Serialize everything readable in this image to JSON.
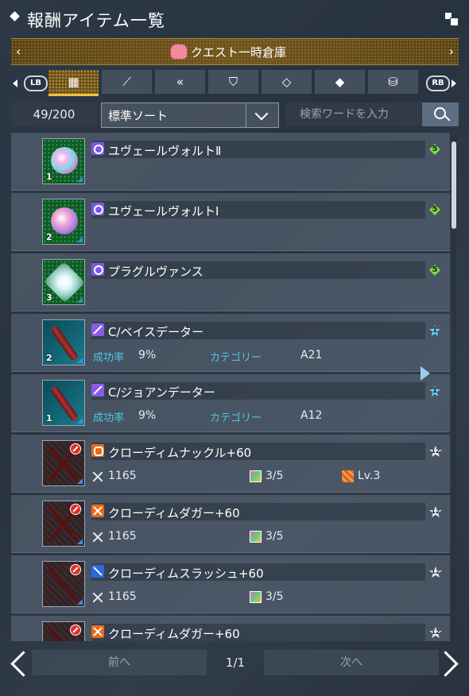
{
  "title": "報酬アイテム一覧",
  "category_banner": {
    "label": "クエスト一時倉庫"
  },
  "tabs": {
    "lb_label": "LB",
    "rb_label": "RB",
    "items": [
      {
        "name": "all-items",
        "icon": "grid-icon"
      },
      {
        "name": "weapons",
        "icon": "sword-icon"
      },
      {
        "name": "units",
        "icon": "double-chevron-icon"
      },
      {
        "name": "costumes",
        "icon": "shirt-icon"
      },
      {
        "name": "consumables",
        "icon": "tag-icon"
      },
      {
        "name": "materials",
        "icon": "diamond-arrow-icon"
      },
      {
        "name": "other",
        "icon": "bag-icon"
      }
    ]
  },
  "filters": {
    "count": "49/200",
    "sort_value": "標準ソート",
    "search_placeholder": "検索ワードを入力"
  },
  "items": [
    {
      "name": "ユヴェールヴォルトⅡ",
      "qty": "1",
      "type_icon": "violet",
      "rarity": "5"
    },
    {
      "name": "ユヴェールヴォルトⅠ",
      "qty": "2",
      "type_icon": "violet",
      "rarity": "5"
    },
    {
      "name": "プラグルヴァンス",
      "qty": "3",
      "type_icon": "violet",
      "rarity": "5"
    },
    {
      "name": "C/ベイスデーター",
      "qty": "2",
      "type_icon": "purple",
      "rarity": "1",
      "success_label": "成功率",
      "success_value": "9%",
      "category_label": "カテゴリー",
      "category_value": "A21"
    },
    {
      "name": "C/ジョアンデーター",
      "qty": "1",
      "type_icon": "purple",
      "rarity": "1",
      "success_label": "成功率",
      "success_value": "9%",
      "category_label": "カテゴリー",
      "category_value": "A12"
    },
    {
      "name": "クローディムナックル+60",
      "type_icon": "orange",
      "rarity": "12",
      "attack": "1165",
      "slots": "3/5",
      "augment": "Lv.3"
    },
    {
      "name": "クローディムダガー+60",
      "type_icon": "xorange",
      "rarity": "12",
      "attack": "1165",
      "slots": "3/5"
    },
    {
      "name": "クローディムスラッシュ+60",
      "type_icon": "blue",
      "rarity": "12",
      "attack": "1165",
      "slots": "3/5"
    },
    {
      "name": "クローディムダガー+60",
      "type_icon": "xorange",
      "rarity": "12"
    }
  ],
  "pagination": {
    "prev_label": "前へ",
    "page": "1/1",
    "next_label": "次へ"
  },
  "colors": {
    "accent_gold": "#f0c040",
    "label_cyan": "#4ec8e6",
    "rarity_green": "#7ad84a",
    "rarity_cyan": "#6ad0f0"
  }
}
